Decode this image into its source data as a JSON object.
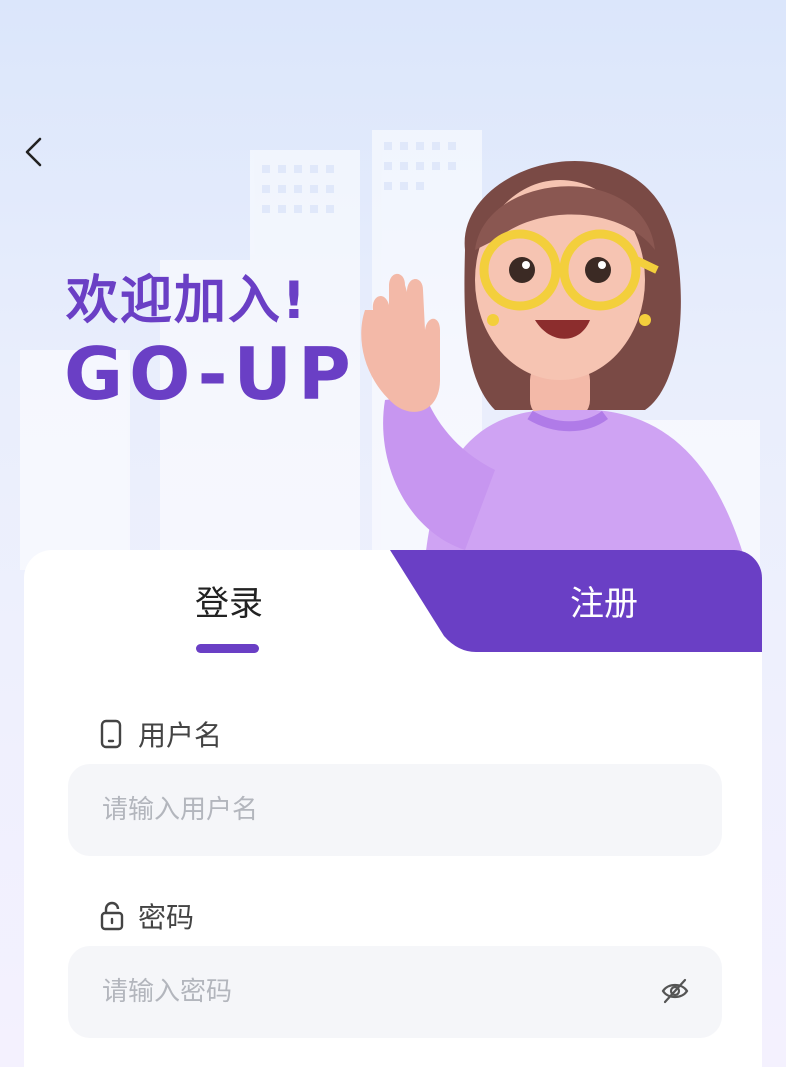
{
  "header": {
    "back_icon": "chevron-left-icon",
    "welcome": "欢迎加入!",
    "brand": "GO-UP"
  },
  "tabs": {
    "login": "登录",
    "register": "注册",
    "active": "login"
  },
  "form": {
    "username": {
      "label": "用户名",
      "icon": "phone-icon",
      "placeholder": "请输入用户名",
      "value": ""
    },
    "password": {
      "label": "密码",
      "icon": "lock-icon",
      "placeholder": "请输入密码",
      "value": "",
      "toggle_icon": "eye-off-icon"
    }
  },
  "colors": {
    "accent": "#6a3fc5",
    "input_bg": "#f5f6f9",
    "placeholder": "#b3b6bd"
  }
}
